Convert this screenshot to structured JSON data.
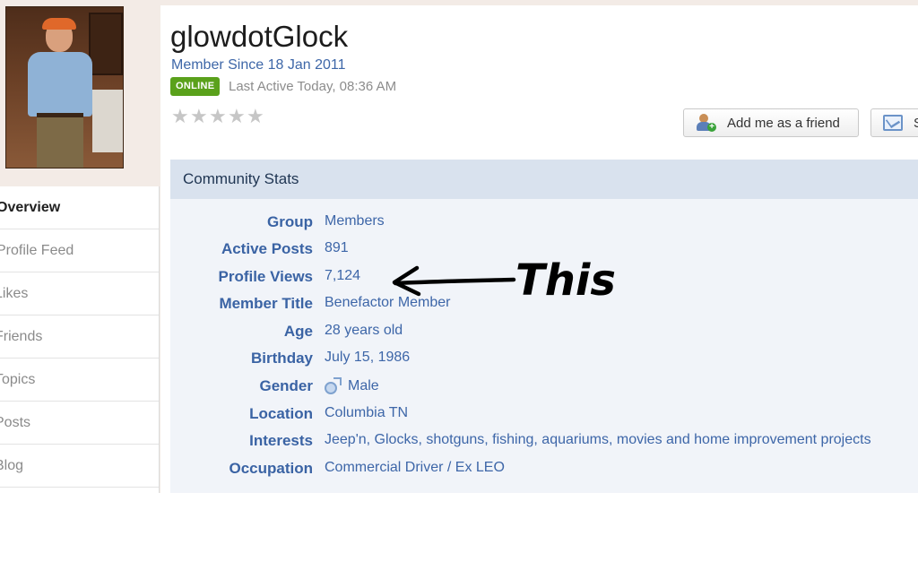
{
  "profile": {
    "username": "glowdotGlock",
    "member_since": "Member Since 18 Jan 2011",
    "online_badge": "ONLINE",
    "last_active": "Last Active Today, 08:36 AM",
    "rating_stars": 5
  },
  "actions": {
    "add_friend_label": "Add me as a friend",
    "message_label": "S"
  },
  "sidebar": {
    "items": [
      {
        "label": "Overview",
        "active": true
      },
      {
        "label": "Profile Feed",
        "active": false
      },
      {
        "label": "Likes",
        "active": false
      },
      {
        "label": "Friends",
        "active": false
      },
      {
        "label": "Topics",
        "active": false
      },
      {
        "label": "Posts",
        "active": false
      },
      {
        "label": "Blog",
        "active": false
      }
    ]
  },
  "stats": {
    "header": "Community Stats",
    "rows": [
      {
        "label": "Group",
        "value": "Members"
      },
      {
        "label": "Active Posts",
        "value": "891"
      },
      {
        "label": "Profile Views",
        "value": "7,124"
      },
      {
        "label": "Member Title",
        "value": "Benefactor Member"
      },
      {
        "label": "Age",
        "value": "28 years old"
      },
      {
        "label": "Birthday",
        "value": "July 15, 1986"
      },
      {
        "label": "Gender",
        "value": "Male"
      },
      {
        "label": "Location",
        "value": "Columbia TN"
      },
      {
        "label": "Interests",
        "value": "Jeep'n, Glocks, shotguns, fishing, aquariums, movies and home improvement projects"
      },
      {
        "label": "Occupation",
        "value": "Commercial Driver / Ex LEO"
      }
    ]
  },
  "annotation": {
    "text": "This"
  },
  "colors": {
    "accent_blue": "#3a63a4",
    "online_green": "#5aa11b",
    "header_bg": "#d9e2ee"
  }
}
